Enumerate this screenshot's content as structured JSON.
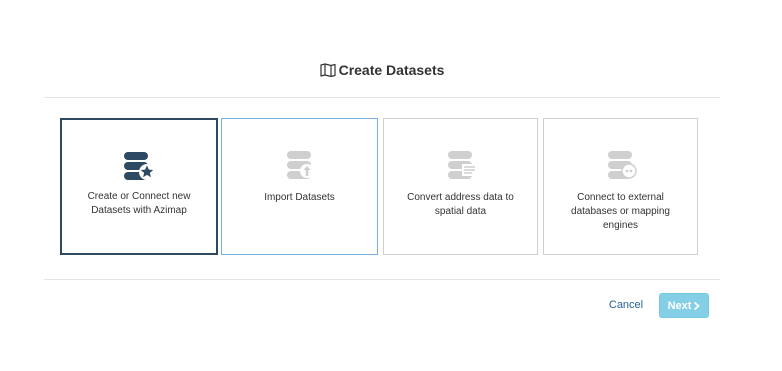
{
  "dialog": {
    "title": "Create Datasets",
    "title_icon": "map-book-icon"
  },
  "options": [
    {
      "label": "Create or Connect new Datasets with Azimap",
      "icon": "database-star-icon",
      "state": "selected"
    },
    {
      "label": "Import Datasets",
      "icon": "database-upload-icon",
      "state": "hover"
    },
    {
      "label": "Convert address data to spatial data",
      "icon": "database-list-icon",
      "state": "default"
    },
    {
      "label": "Connect to external databases or mapping engines",
      "icon": "database-connect-icon",
      "state": "default"
    }
  ],
  "footer": {
    "cancel_label": "Cancel",
    "next_label": "Next",
    "next_icon": "chevron-right-icon"
  },
  "colors": {
    "selected_border": "#2e4a62",
    "hover_border": "#7aaee0",
    "selected_icon": "#2e4a62",
    "muted_icon": "#cfcfcf",
    "next_button": "#5bc0de",
    "cancel_link": "#2a6496"
  }
}
